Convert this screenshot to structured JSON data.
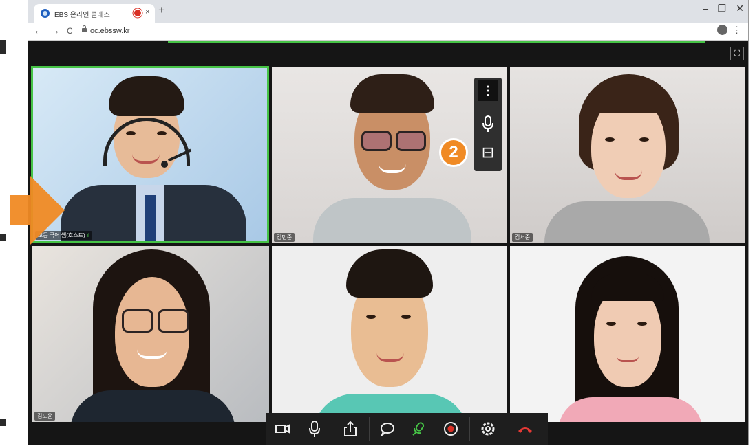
{
  "browser": {
    "tab_title": "EBS 온라인 클래스",
    "tab_close": "×",
    "new_tab": "+",
    "url": "oc.ebssw.kr",
    "back": "←",
    "forward": "→",
    "reload": "C",
    "minimize": "–",
    "restore": "❐",
    "close": "✕",
    "menu": "⋮"
  },
  "class": {
    "fullscreen_icon": "⛶",
    "participants": [
      {
        "name": "고등 국어 쌤(호스트)",
        "role": "host",
        "active_speaker": true
      },
      {
        "name": "김민준"
      },
      {
        "name": "김서준"
      },
      {
        "name": "김도윤"
      },
      {
        "name": "",
        "name_shown": false
      },
      {
        "name": "",
        "name_shown": false
      }
    ],
    "tile_menu": {
      "more_icon": "⋮",
      "mic_icon": "microphone-icon",
      "minimize_icon": "⊟"
    },
    "step_badge": "2",
    "toolbar": [
      "camera-icon",
      "microphone-icon",
      "share-icon",
      "chat-icon",
      "participants-mic-icon",
      "record-icon",
      "settings-icon",
      "leave-call-icon"
    ]
  },
  "colors": {
    "accent_green": "#46c346",
    "badge_orange": "#f08a24",
    "record_red": "#d93025",
    "leave_red": "#e53935"
  }
}
